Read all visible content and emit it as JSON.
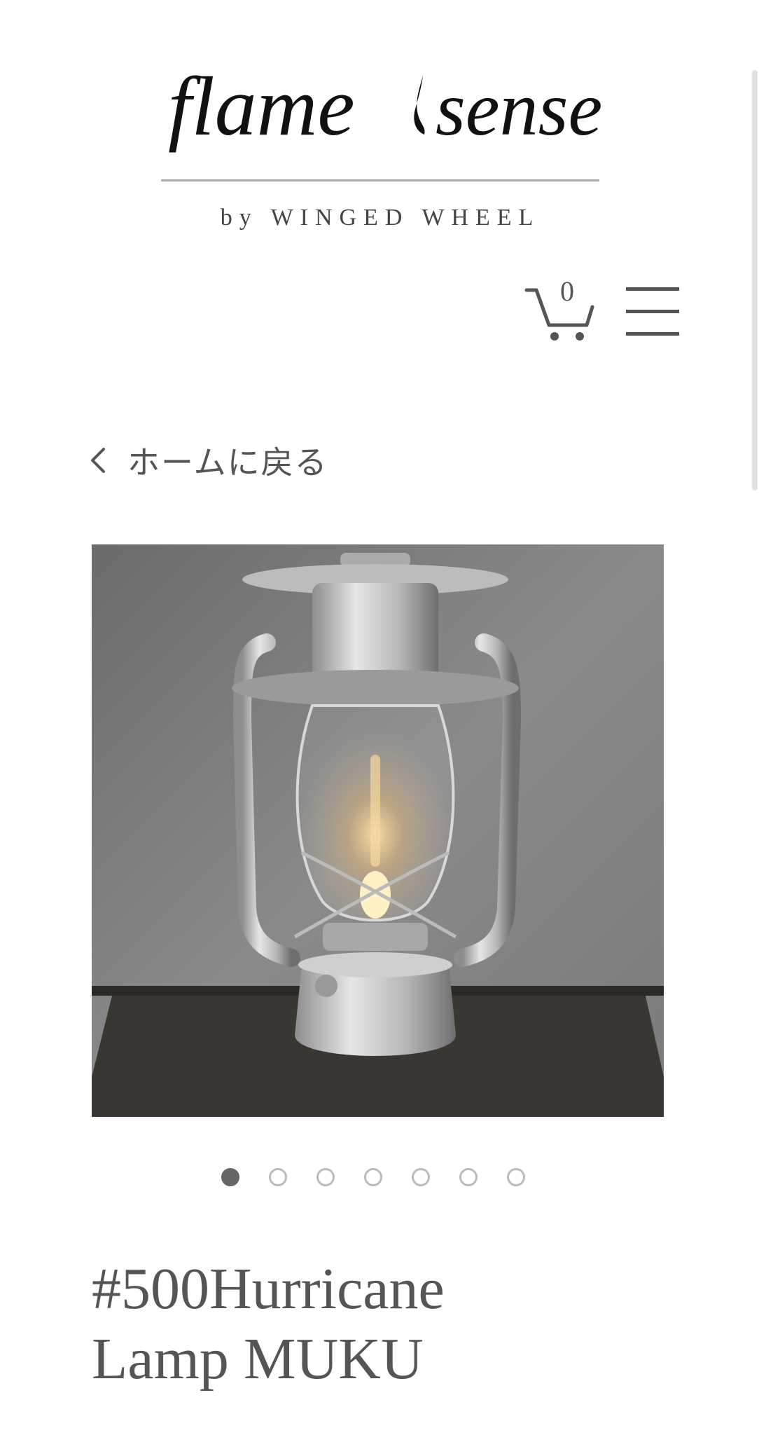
{
  "logo": {
    "wordmark_left": "flame",
    "wordmark_right": "sense",
    "tagline": "by WINGED WHEEL"
  },
  "header": {
    "cart_count": "0",
    "cart_icon": "cart-icon",
    "menu_icon": "hamburger-menu-icon"
  },
  "nav": {
    "back_label": "ホームに戻る",
    "back_icon": "chevron-left-icon"
  },
  "product": {
    "image_label": "hurricane lantern photo",
    "gallery": {
      "count": 7,
      "active_index": 0
    },
    "title_line1": "#500Hurricane",
    "title_line2": "Lamp MUKU"
  },
  "colors": {
    "text": "#555555",
    "dot_active": "#666666",
    "dot_inactive": "#bbbbbb"
  }
}
